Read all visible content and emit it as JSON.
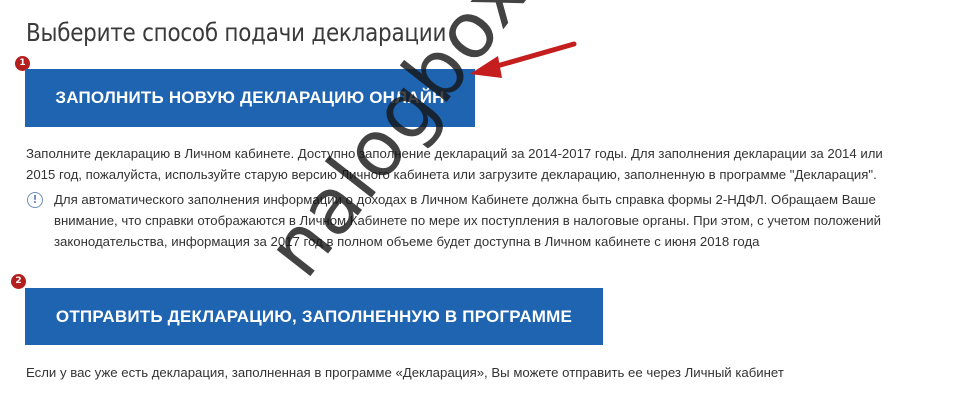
{
  "page": {
    "title": "Выберите способ подачи декларации"
  },
  "option1": {
    "step": "1",
    "button_label": "ЗАПОЛНИТЬ НОВУЮ ДЕКЛАРАЦИЮ ОНЛАЙН",
    "description_line1": "Заполните декларацию в Личном кабинете. Доступно заполнение деклараций за 2014-2017 годы. Для заполнения декларации за 2014 или",
    "description_line2": "2015 год, пожалуйста, используйте старую версию Личного кабинета или загрузите декларацию, заполненную в программе \"Декларация\".",
    "info_line1": "Для автоматического заполнения информации о доходах в Личном Кабинете должна быть справка формы 2-НДФЛ. Обращаем Ваше",
    "info_line2": "внимание, что справки отображаются в Личном Кабинете по мере их поступления в налоговые органы. При этом, с учетом положений",
    "info_line3": "законодательства, информация за 2017 год в полном объеме будет доступна в Личном кабинете с июня 2018 года"
  },
  "option2": {
    "step": "2",
    "button_label": "ОТПРАВИТЬ ДЕКЛАРАЦИЮ, ЗАПОЛНЕННУЮ В ПРОГРАММЕ",
    "description": "Если у вас уже есть декларация, заполненная в программе «Декларация», Вы можете отправить ее через Личный кабинет"
  },
  "watermark": "nalogbox.ru",
  "colors": {
    "button": "#1e64b0",
    "badge": "#b31e1e",
    "arrow": "#c41e1e"
  },
  "icons": {
    "info": "info-circle-icon",
    "pointer": "red-arrow-icon"
  }
}
